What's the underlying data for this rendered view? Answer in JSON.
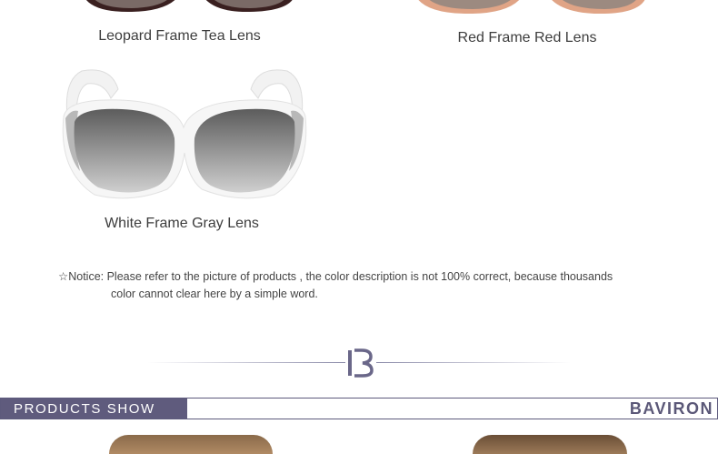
{
  "products": [
    {
      "caption": "Leopard Frame Tea Lens"
    },
    {
      "caption": "Red Frame Red Lens"
    },
    {
      "caption": "White Frame Gray Lens"
    }
  ],
  "notice": {
    "symbol": "☆",
    "line1": "Notice: Please refer to the picture of products , the color description is not 100% correct, because thousands",
    "line2": "color cannot clear here by a simple word."
  },
  "section": {
    "tab_label": "PRODUCTS SHOW",
    "brand": "BAVIRON"
  },
  "colors": {
    "accent": "#5f5b7d",
    "leopard_frame": "#5a2a2a",
    "red_frame": "#d89a7a",
    "white_frame": "#f4f4f4",
    "gray_lens": "#6a6a6a"
  }
}
